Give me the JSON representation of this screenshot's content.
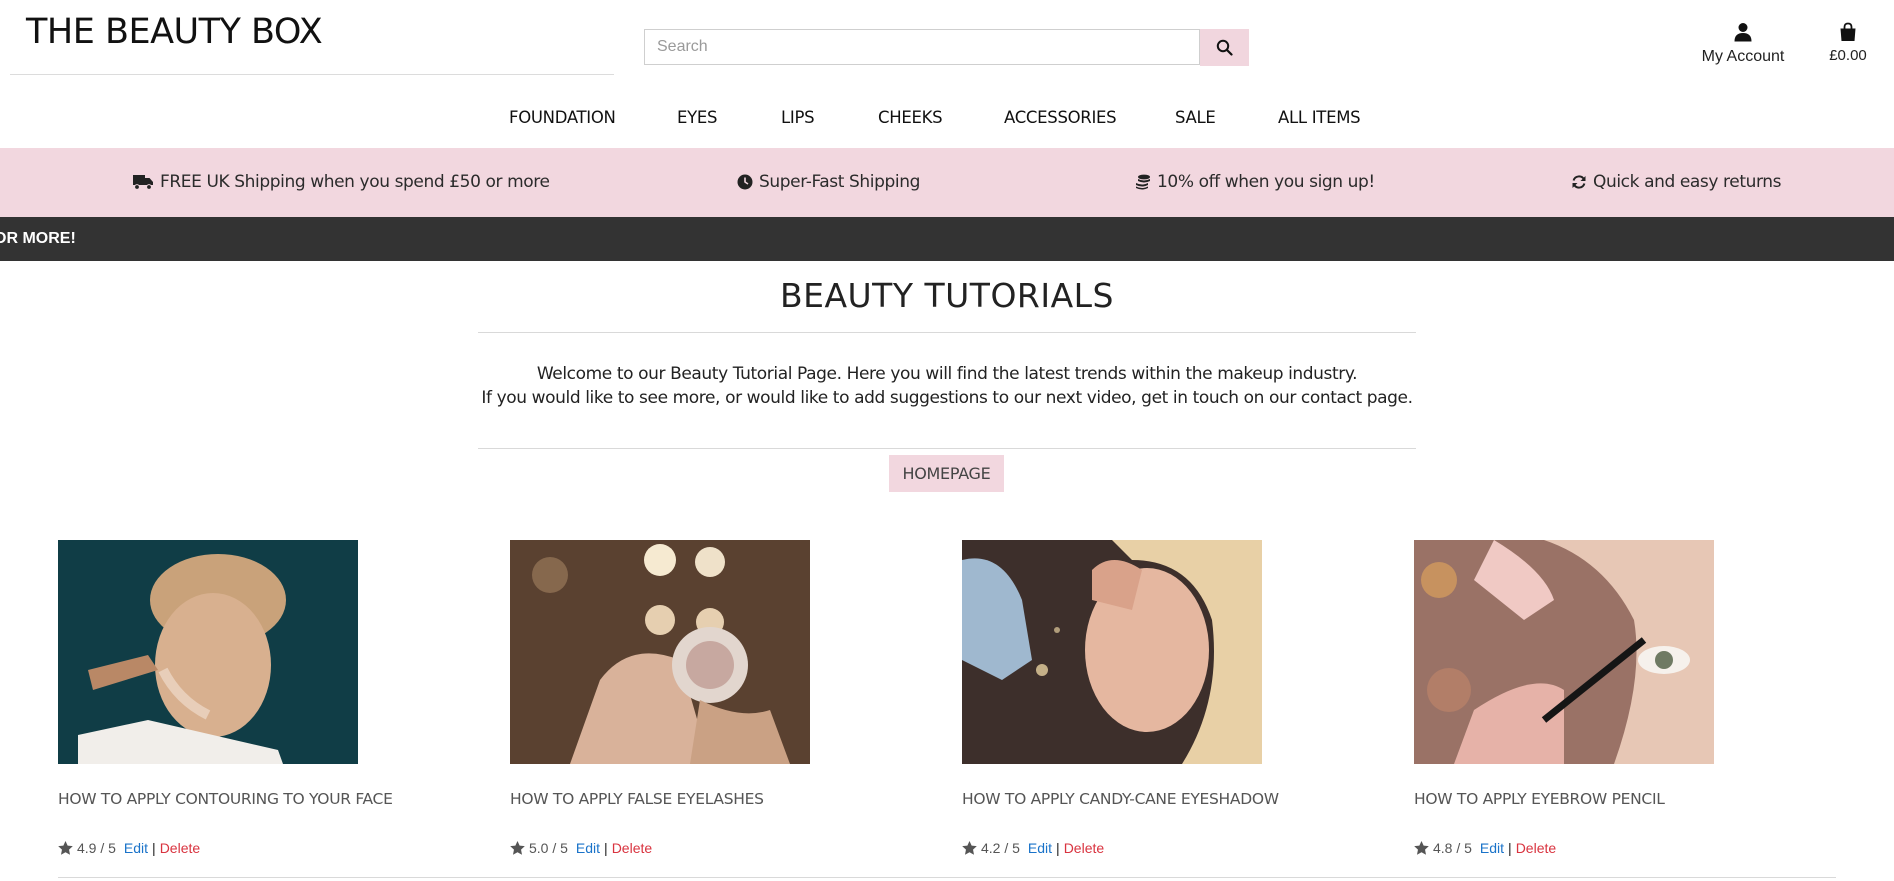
{
  "header": {
    "logo": "THE BEAUTY BOX",
    "search_placeholder": "Search",
    "account_label": "My Account",
    "bag_total": "£0.00"
  },
  "nav": {
    "items": [
      "FOUNDATION",
      "EYES",
      "LIPS",
      "CHEEKS",
      "ACCESSORIES",
      "SALE",
      "ALL ITEMS"
    ]
  },
  "benefits": [
    {
      "icon": "truck-icon",
      "text": "FREE UK Shipping when you spend £50 or more"
    },
    {
      "icon": "clock-icon",
      "text": "Super-Fast Shipping"
    },
    {
      "icon": "coins-icon",
      "text": "10% off when you sign up!"
    },
    {
      "icon": "sync-icon",
      "text": "Quick and easy returns"
    }
  ],
  "ticker": {
    "text": "OR MORE!"
  },
  "main": {
    "title": "BEAUTY TUTORIALS",
    "intro_line1": "Welcome to our Beauty Tutorial Page. Here you will find the latest trends within the makeup industry.",
    "intro_line2": "If you would like to see more, or would like to add suggestions to our next video, get in touch on our contact page.",
    "homepage_button": "HOMEPAGE"
  },
  "tutorials": [
    {
      "title": "HOW TO APPLY CONTOURING TO YOUR FACE",
      "rating": "4.9 / 5",
      "edit": "Edit",
      "sep": "|",
      "delete": "Delete"
    },
    {
      "title": "HOW TO APPLY FALSE EYELASHES",
      "rating": "5.0 / 5",
      "edit": "Edit",
      "sep": "|",
      "delete": "Delete"
    },
    {
      "title": "HOW TO APPLY CANDY-CANE EYESHADOW",
      "rating": "4.2 / 5",
      "edit": "Edit",
      "sep": "|",
      "delete": "Delete"
    },
    {
      "title": "HOW TO APPLY EYEBROW PENCIL",
      "rating": "4.8 / 5",
      "edit": "Edit",
      "sep": "|",
      "delete": "Delete"
    }
  ],
  "colors": {
    "accent_pink": "#f2d7df",
    "ticker_bg": "#333333",
    "edit_link": "#1a73c9",
    "delete_link": "#d9333f"
  }
}
